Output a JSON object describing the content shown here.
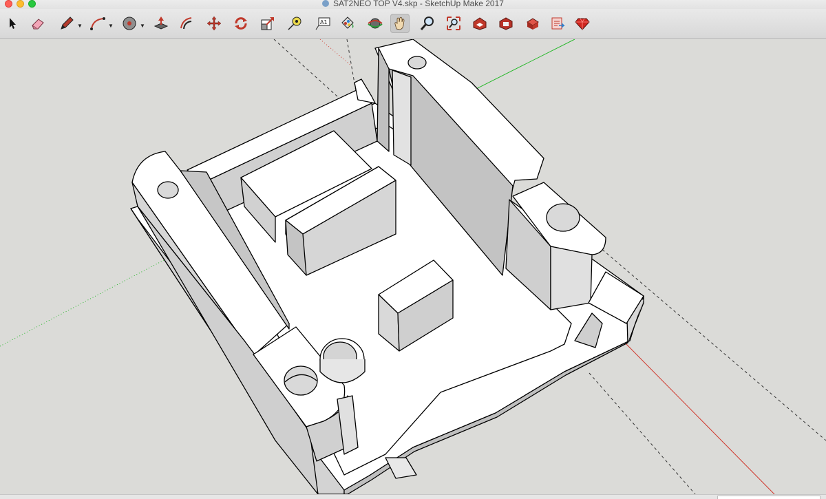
{
  "window": {
    "title": "SAT2NEO TOP V4.skp - SketchUp Make 2017"
  },
  "toolbar": {
    "tools": [
      {
        "name": "select-tool",
        "icon": "arrow-cursor-icon"
      },
      {
        "name": "eraser-tool",
        "icon": "eraser-icon"
      },
      {
        "name": "line-tool",
        "icon": "pencil-icon",
        "dropdown": true
      },
      {
        "name": "arc-tool",
        "icon": "arc-icon",
        "dropdown": true
      },
      {
        "name": "shapes-tool",
        "icon": "circle-shape-icon",
        "dropdown": true
      },
      {
        "name": "push-pull-tool",
        "icon": "push-pull-icon"
      },
      {
        "name": "offset-tool",
        "icon": "offset-icon"
      },
      {
        "name": "move-tool",
        "icon": "move-arrows-icon"
      },
      {
        "name": "rotate-tool",
        "icon": "rotate-icon"
      },
      {
        "name": "scale-tool",
        "icon": "scale-icon"
      },
      {
        "name": "tape-measure-tool",
        "icon": "tape-measure-icon"
      },
      {
        "name": "text-tool",
        "icon": "text-icon"
      },
      {
        "name": "paint-bucket-tool",
        "icon": "paint-bucket-icon"
      },
      {
        "name": "orbit-tool",
        "icon": "orbit-icon"
      },
      {
        "name": "pan-tool",
        "icon": "hand-icon",
        "active": true
      },
      {
        "name": "zoom-tool",
        "icon": "magnifier-icon"
      },
      {
        "name": "zoom-extents-tool",
        "icon": "zoom-extents-icon"
      },
      {
        "name": "3d-warehouse-tool",
        "icon": "warehouse-icon"
      },
      {
        "name": "share-model-tool",
        "icon": "share-model-icon"
      },
      {
        "name": "extension-warehouse-tool",
        "icon": "extension-warehouse-icon"
      },
      {
        "name": "layout-send-tool",
        "icon": "layout-icon"
      },
      {
        "name": "extension-manager-tool",
        "icon": "ruby-gem-icon"
      }
    ]
  },
  "colors": {
    "axis_red": "#d0362b",
    "axis_green": "#27b82a",
    "axis_blue": "#3a4ac0",
    "model_face": "#ffffff",
    "model_shade": "#c9c9c9",
    "background": "#dbdbd8"
  }
}
